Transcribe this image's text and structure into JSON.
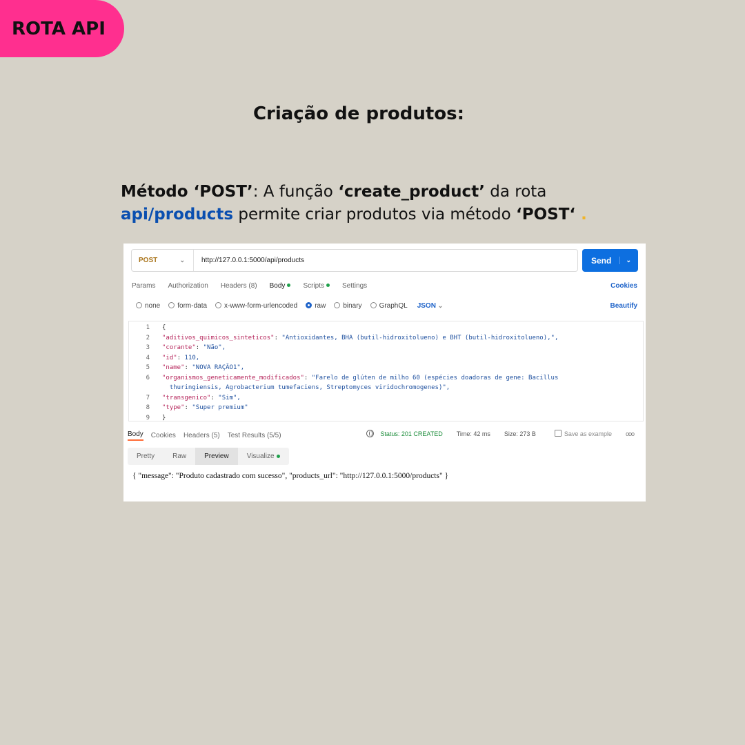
{
  "badge": "ROTA API",
  "title": "Criação de produtos:",
  "description": {
    "method_label": "Método ‘POST’",
    "text1": ": A função ",
    "function_name": "‘create_product’",
    "text2": " da rota ",
    "route": "api/products",
    "text3": " permite criar produtos via método ",
    "method_again": "‘POST‘",
    "dot": " ."
  },
  "request": {
    "method": "POST",
    "url": "http://127.0.0.1:5000/api/products",
    "send_label": "Send"
  },
  "tabs": [
    "Params",
    "Authorization",
    "Headers (8)",
    "Body",
    "Scripts",
    "Settings"
  ],
  "cookies_label": "Cookies",
  "body_types": [
    "none",
    "form-data",
    "x-www-form-urlencoded",
    "raw",
    "binary",
    "GraphQL"
  ],
  "json_label": "JSON",
  "beautify_label": "Beautify",
  "code_lines": [
    {
      "n": "1",
      "t": "{"
    },
    {
      "n": "2",
      "k": "\"aditivos_quimicos_sinteticos\"",
      "v": "\"Antioxidantes, BHA (butil-hidroxitolueno) e BHT (butil-hidroxitolueno),\","
    },
    {
      "n": "3",
      "k": "\"corante\"",
      "v": "\"Não\","
    },
    {
      "n": "4",
      "k": "\"id\"",
      "v": "110,"
    },
    {
      "n": "5",
      "k": "\"name\"",
      "v": "\"NOVA RAÇÃO1\","
    },
    {
      "n": "6",
      "k": "\"organismos_geneticamente_modificados\"",
      "v": "\"Farelo de glúten de milho 60 (espécies doadoras de gene: Bacillus"
    },
    {
      "n": "",
      "t": "  thuringiensis, Agrobacterium tumefaciens, Streptomyces viridochromogenes)\","
    },
    {
      "n": "7",
      "k": "\"transgenico\"",
      "v": "\"Sim\","
    },
    {
      "n": "8",
      "k": "\"type\"",
      "v": "\"Super premium\""
    },
    {
      "n": "9",
      "t": "}"
    }
  ],
  "response": {
    "tabs": [
      "Body",
      "Cookies",
      "Headers (5)",
      "Test Results (5/5)"
    ],
    "status": "Status: 201 CREATED",
    "time": "Time: 42 ms",
    "size": "Size: 273 B",
    "save_label": "Save as example",
    "more": "ooo",
    "views": [
      "Pretty",
      "Raw",
      "Preview",
      "Visualize"
    ],
    "result": "{ \"message\": \"Produto cadastrado com sucesso\", \"products_url\": \"http://127.0.0.1:5000/products\" }"
  }
}
